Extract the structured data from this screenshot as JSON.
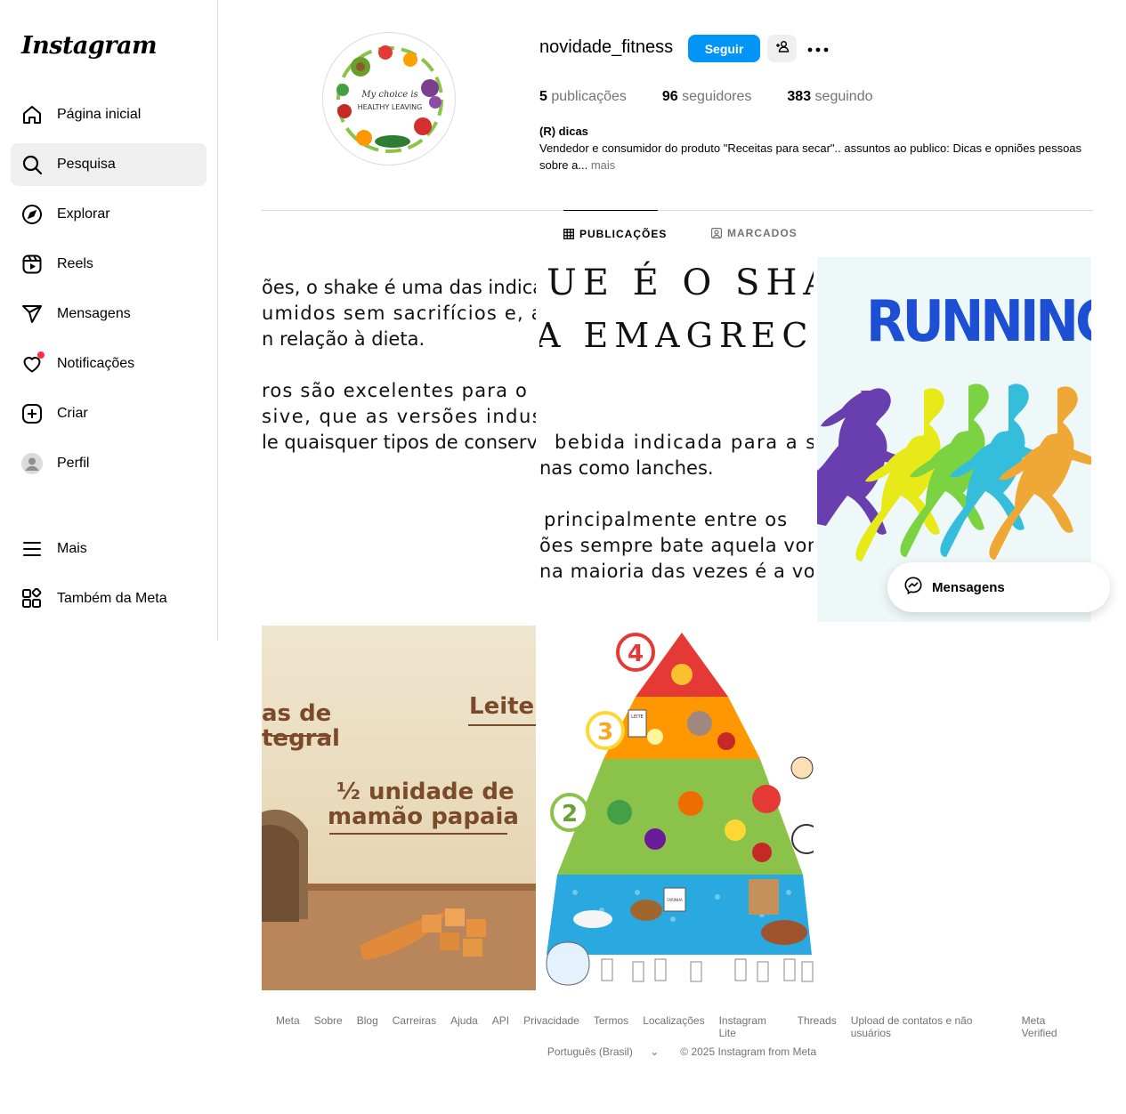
{
  "app": {
    "logo": "Instagram"
  },
  "sidebar": {
    "items": [
      {
        "label": "Página inicial",
        "icon": "home-icon"
      },
      {
        "label": "Pesquisa",
        "icon": "search-icon"
      },
      {
        "label": "Explorar",
        "icon": "compass-icon"
      },
      {
        "label": "Reels",
        "icon": "reels-icon"
      },
      {
        "label": "Mensagens",
        "icon": "send-icon"
      },
      {
        "label": "Notificações",
        "icon": "heart-icon"
      },
      {
        "label": "Criar",
        "icon": "plus-square-icon"
      },
      {
        "label": "Perfil",
        "icon": "avatar-icon"
      },
      {
        "label": "Mais",
        "icon": "menu-icon"
      },
      {
        "label": "Também da Meta",
        "icon": "meta-apps-icon"
      }
    ]
  },
  "profile": {
    "username": "novidade_fitness",
    "follow_label": "Seguir",
    "stats": {
      "posts_count": "5",
      "posts_label": "publicações",
      "followers_count": "96",
      "followers_label": "seguidores",
      "following_count": "383",
      "following_label": "seguindo"
    },
    "full_name": "(R) dicas",
    "bio": "Vendedor e consumidor do produto \"Receitas para secar\".. assuntos ao publico: Dicas e opniões pessoas sobre a...",
    "bio_more": "mais",
    "avatar_text_1": "My choice is",
    "avatar_text_2": "HEALTHY LEAVING"
  },
  "tabs": [
    {
      "label": "PUBLICAÇÕES",
      "active": true
    },
    {
      "label": "MARCADOS",
      "active": false
    }
  ],
  "posts": {
    "post1_lines": [
      "ões, o shake é uma das indicaç",
      "umidos sem sacrifícios e, ain",
      "n relação à dieta.",
      "ros são excelentes para o er",
      "sive, que as versões indust",
      "le quaisquer tipos de conserva"
    ],
    "post2_caps": [
      "UE É O SHA",
      "A EMAGREC"
    ],
    "post2_lines": [
      "bebida indicada para a su",
      "nas como lanches.",
      "principalmente entre os",
      "ões sempre bate aquela vont",
      "na maioria das vezes é a von"
    ],
    "post3_title": "RUNNING",
    "post4_texts": {
      "line1": "as de",
      "line2": "tegral",
      "leite": "Leite",
      "papaia1": "½ unidade de",
      "papaia2": "mamão papaia"
    },
    "post5_labels": {
      "g4": "4",
      "g3": "3",
      "g2": "2",
      "leite": "LEITE",
      "farinha": "FARINHA"
    }
  },
  "messages_pill": {
    "label": "Mensagens"
  },
  "footer": {
    "links": [
      "Meta",
      "Sobre",
      "Blog",
      "Carreiras",
      "Ajuda",
      "API",
      "Privacidade",
      "Termos",
      "Localizações",
      "Instagram Lite",
      "Threads",
      "Upload de contatos e não usuários",
      "Meta Verified"
    ],
    "language": "Português (Brasil)",
    "copyright": "© 2025 Instagram from Meta"
  },
  "colors": {
    "accent": "#0095f6",
    "notification": "#ff3040",
    "running_title": "#1d4fd4"
  }
}
